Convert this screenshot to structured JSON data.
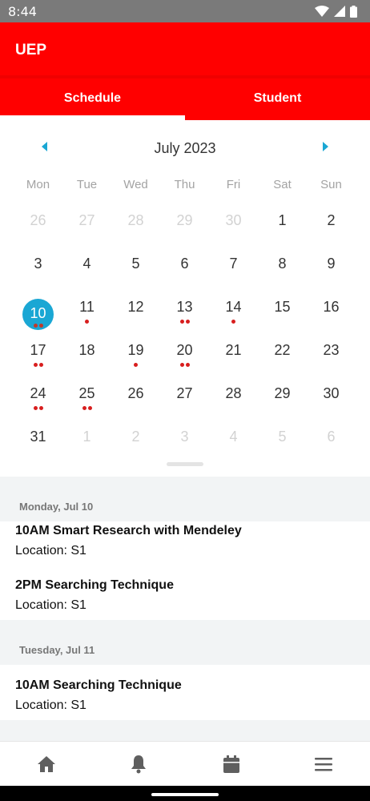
{
  "status_bar": {
    "time": "8:44"
  },
  "app_bar": {
    "title": "UEP"
  },
  "tabs": [
    {
      "label": "Schedule",
      "active": true
    },
    {
      "label": "Student",
      "active": false
    }
  ],
  "calendar": {
    "month_label": "July 2023",
    "weekdays": [
      "Mon",
      "Tue",
      "Wed",
      "Thu",
      "Fri",
      "Sat",
      "Sun"
    ],
    "selected_day": "10",
    "days": [
      {
        "d": "26",
        "other": true,
        "dots": 0
      },
      {
        "d": "27",
        "other": true,
        "dots": 0
      },
      {
        "d": "28",
        "other": true,
        "dots": 0
      },
      {
        "d": "29",
        "other": true,
        "dots": 0
      },
      {
        "d": "30",
        "other": true,
        "dots": 0
      },
      {
        "d": "1",
        "other": false,
        "dots": 0
      },
      {
        "d": "2",
        "other": false,
        "dots": 0
      },
      {
        "d": "3",
        "other": false,
        "dots": 0
      },
      {
        "d": "4",
        "other": false,
        "dots": 0
      },
      {
        "d": "5",
        "other": false,
        "dots": 0
      },
      {
        "d": "6",
        "other": false,
        "dots": 0
      },
      {
        "d": "7",
        "other": false,
        "dots": 0
      },
      {
        "d": "8",
        "other": false,
        "dots": 0
      },
      {
        "d": "9",
        "other": false,
        "dots": 0
      },
      {
        "d": "10",
        "other": false,
        "dots": 2,
        "selected": true
      },
      {
        "d": "11",
        "other": false,
        "dots": 1
      },
      {
        "d": "12",
        "other": false,
        "dots": 0
      },
      {
        "d": "13",
        "other": false,
        "dots": 2
      },
      {
        "d": "14",
        "other": false,
        "dots": 1
      },
      {
        "d": "15",
        "other": false,
        "dots": 0
      },
      {
        "d": "16",
        "other": false,
        "dots": 0
      },
      {
        "d": "17",
        "other": false,
        "dots": 2
      },
      {
        "d": "18",
        "other": false,
        "dots": 0
      },
      {
        "d": "19",
        "other": false,
        "dots": 1
      },
      {
        "d": "20",
        "other": false,
        "dots": 2
      },
      {
        "d": "21",
        "other": false,
        "dots": 0
      },
      {
        "d": "22",
        "other": false,
        "dots": 0
      },
      {
        "d": "23",
        "other": false,
        "dots": 0
      },
      {
        "d": "24",
        "other": false,
        "dots": 2
      },
      {
        "d": "25",
        "other": false,
        "dots": 2
      },
      {
        "d": "26",
        "other": false,
        "dots": 0
      },
      {
        "d": "27",
        "other": false,
        "dots": 0
      },
      {
        "d": "28",
        "other": false,
        "dots": 0
      },
      {
        "d": "29",
        "other": false,
        "dots": 0
      },
      {
        "d": "30",
        "other": false,
        "dots": 0
      },
      {
        "d": "31",
        "other": false,
        "dots": 0
      },
      {
        "d": "1",
        "other": true,
        "dots": 0
      },
      {
        "d": "2",
        "other": true,
        "dots": 0
      },
      {
        "d": "3",
        "other": true,
        "dots": 0
      },
      {
        "d": "4",
        "other": true,
        "dots": 0
      },
      {
        "d": "5",
        "other": true,
        "dots": 0
      },
      {
        "d": "6",
        "other": true,
        "dots": 0
      }
    ]
  },
  "agenda": [
    {
      "date_label": "Monday, Jul 10",
      "events": [
        {
          "title": "10AM Smart Research with Mendeley",
          "location": "Location: S1"
        },
        {
          "title": "2PM Searching Technique",
          "location": "Location: S1"
        }
      ]
    },
    {
      "date_label": "Tuesday, Jul 11",
      "events": [
        {
          "title": "10AM Searching Technique",
          "location": "Location: S1"
        }
      ]
    }
  ],
  "bottom_nav": [
    {
      "icon": "home-icon"
    },
    {
      "icon": "bell-icon"
    },
    {
      "icon": "calendar-icon"
    },
    {
      "icon": "menu-icon"
    }
  ],
  "colors": {
    "primary": "#ff0000",
    "accent": "#1aa7d4",
    "event_dot": "#d81e1e"
  }
}
